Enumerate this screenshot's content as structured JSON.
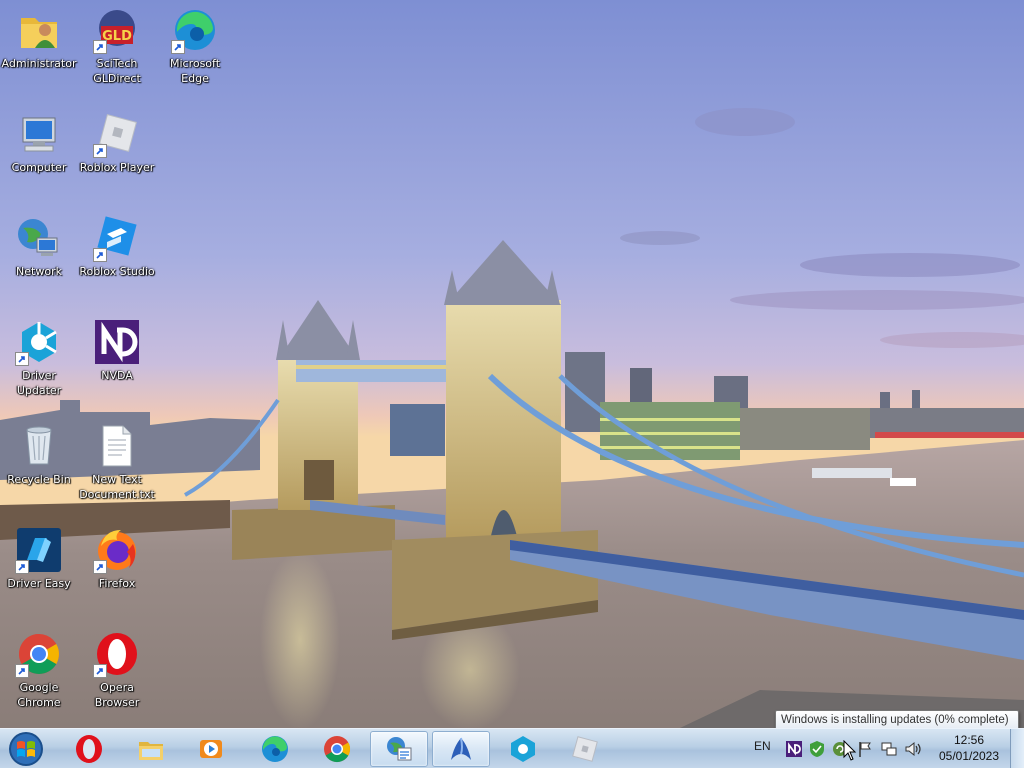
{
  "desktop": {
    "icons": [
      {
        "label": "Administrator",
        "icon": "user-folder-icon"
      },
      {
        "label": "SciTech\nGLDirect",
        "icon": "gldirect-icon"
      },
      {
        "label": "Microsoft\nEdge",
        "icon": "edge-icon"
      },
      {
        "label": "Computer",
        "icon": "computer-icon"
      },
      {
        "label": "Roblox Player",
        "icon": "roblox-player-icon"
      },
      {
        "label": "Network",
        "icon": "network-icon"
      },
      {
        "label": "Roblox Studio",
        "icon": "roblox-studio-icon"
      },
      {
        "label": "Driver\nUpdater",
        "icon": "driver-updater-icon"
      },
      {
        "label": "NVDA",
        "icon": "nvda-icon"
      },
      {
        "label": "Recycle Bin",
        "icon": "recycle-bin-icon"
      },
      {
        "label": "New Text\nDocument.txt",
        "icon": "text-document-icon"
      },
      {
        "label": "Driver Easy",
        "icon": "driver-easy-icon"
      },
      {
        "label": "Firefox",
        "icon": "firefox-icon"
      },
      {
        "label": "Google\nChrome",
        "icon": "chrome-icon"
      },
      {
        "label": "Opera\nBrowser",
        "icon": "opera-icon"
      }
    ]
  },
  "taskbar": {
    "start_icon": "windows-start-icon",
    "pinned": [
      {
        "name": "opera-icon"
      },
      {
        "name": "file-explorer-icon"
      },
      {
        "name": "media-player-icon"
      },
      {
        "name": "edge-icon"
      },
      {
        "name": "chrome-icon"
      },
      {
        "name": "control-panel-icon",
        "active": true
      },
      {
        "name": "nvda-app-icon",
        "active": true
      },
      {
        "name": "driver-updater-icon"
      },
      {
        "name": "roblox-icon"
      }
    ],
    "tray": {
      "language": "EN",
      "icons": [
        "nvda-tray-icon",
        "security-shield-icon",
        "windows-update-icon",
        "action-center-flag-icon",
        "network-tray-icon",
        "volume-icon"
      ]
    },
    "clock": {
      "time": "12:56",
      "date": "05/01/2023"
    }
  },
  "tooltip": {
    "text": "Windows is installing updates (0% complete)"
  },
  "colors": {
    "sky_top": "#8a98d6",
    "sky_bottom": "#f0c9b0",
    "bridge_blue": "#6f9ed8",
    "stone": "#d9c68f",
    "taskbar": "#c3d6ea"
  }
}
